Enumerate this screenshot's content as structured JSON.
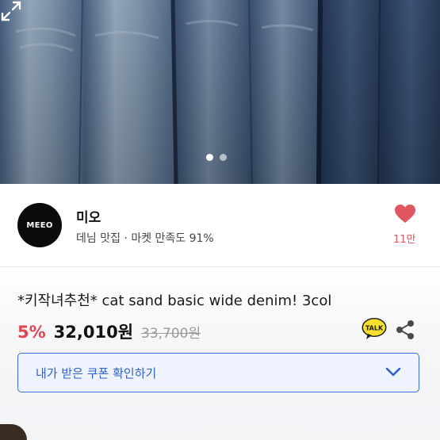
{
  "gallery": {
    "current_index": 1,
    "total": 2,
    "dot_active_color": "#ffffff",
    "dot_inactive_color": "#b8bfc9",
    "expand_icon": "expand-icon"
  },
  "seller": {
    "avatar_text": "MEEO",
    "name": "미오",
    "description": "데님 맛집 · 마켓 만족도 91%",
    "like_icon": "heart-icon",
    "like_count": "11만",
    "like_color": "#e05761"
  },
  "product": {
    "title": "*키작녀추천* cat sand basic wide denim! 3col",
    "discount": "5%",
    "price": "32,010원",
    "original_price": "33,700원",
    "talk_badge": "TALK",
    "share_icon": "share-icon"
  },
  "coupon": {
    "label": "내가 받은 쿠폰 확인하기",
    "chevron_icon": "chevron-down-icon",
    "accent": "#3b6fd8"
  }
}
